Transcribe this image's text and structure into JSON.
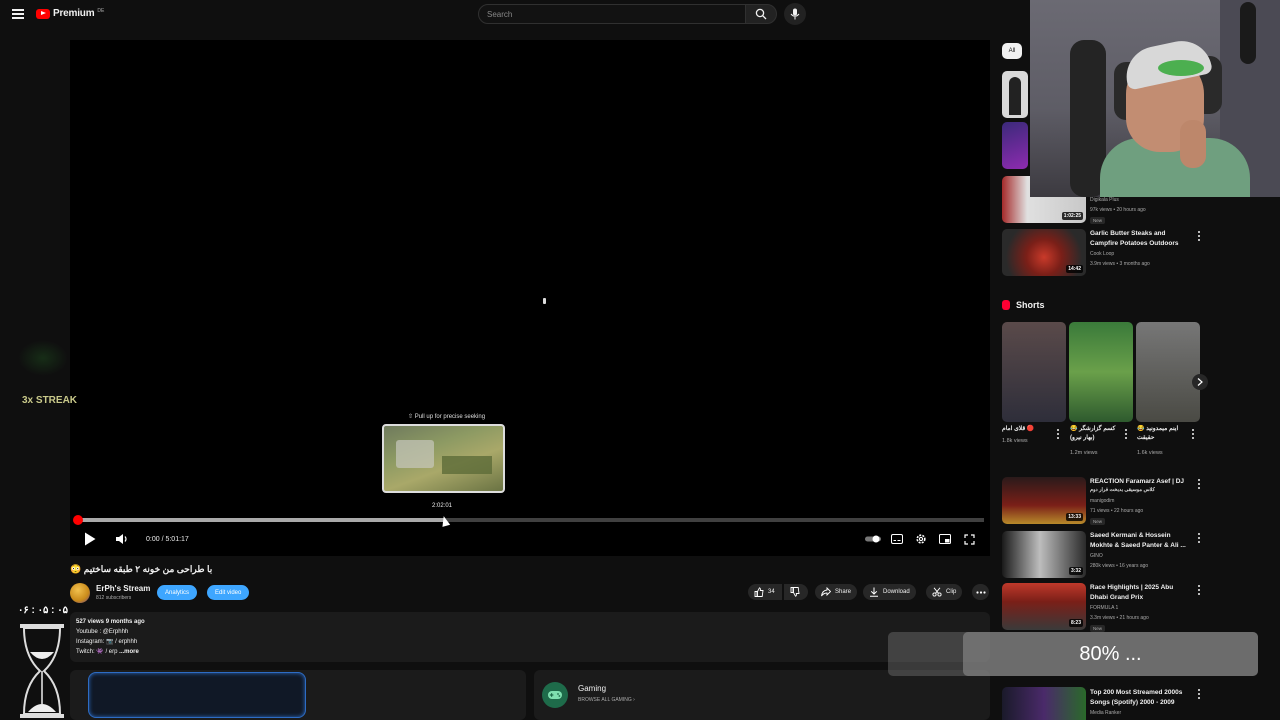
{
  "header": {
    "logo_text": "Premium",
    "logo_sup": "DE",
    "search_placeholder": "Search"
  },
  "player": {
    "seek_hint": "⇧ Pull up for precise seeking",
    "seek_time": "2:02:01",
    "time_display": "0:00 / 5:01:17",
    "progress_played_fraction": 0.0,
    "hover_fraction": 0.406
  },
  "video": {
    "title": "😳 با طراحی من خونه ۲ طبقه ساختیم",
    "channel_name": "ErPh's Stream",
    "subscribers": "812 subscribers",
    "analytics_label": "Analytics",
    "edit_label": "Edit video",
    "likes": "34",
    "share_label": "Share",
    "download_label": "Download",
    "clip_label": "Clip",
    "description": {
      "stats": "527 views  9 months ago",
      "line1": "Youtube : @Erphhh",
      "line2": "Instagram: 📷 / erphhh",
      "line3_prefix": "Twitch: 👾 / erp",
      "more": "...more"
    },
    "gaming_title": "Gaming",
    "gaming_browse": "BROWSE ALL GAMING"
  },
  "overlay": {
    "streak": "3x STREAK",
    "timer": "۰۶ : ۰۵ : ۰۵",
    "loading": "80% ..."
  },
  "sidebar": {
    "chip_all": "All",
    "items": [
      {
        "duration": "",
        "title": "",
        "channel": "",
        "meta": ""
      },
      {
        "duration": "",
        "title": "",
        "channel": "",
        "meta": ""
      },
      {
        "duration": "1:02:25",
        "title": "",
        "channel": "Digikala Plus",
        "meta": "97k views • 20 hours ago",
        "badge": "New"
      },
      {
        "duration": "14:42",
        "title": "Garlic Butter Steaks and Campfire Potatoes Outdoors",
        "channel": "Cook Loop",
        "meta": "3.9m views • 3 months ago"
      },
      {
        "duration": "13:33",
        "title": "REACTION Faramarz Asef | DJ",
        "subtitle": "کلاس موسیقی بدبخت فرار دوم",
        "channel": "manigodim",
        "meta": "71 views • 22 hours ago",
        "badge": "New"
      },
      {
        "duration": "3:32",
        "title": "Saeed Kermani & Hossein Mokhte & Saeed Panter & Ali ...",
        "channel": "GINO",
        "meta": "280k views • 16 years ago"
      },
      {
        "duration": "8:23",
        "title": "Race Highlights | 2025 Abu Dhabi Grand Prix",
        "channel": "FORMULA 1",
        "meta": "3.3m views • 21 hours ago",
        "badge": "New"
      },
      {
        "duration": "",
        "title": "Top 200 Most Streamed 2000s Songs (Spotify) 2000 - 2009",
        "channel": "Media Ranker",
        "meta": ""
      }
    ],
    "shorts_title": "Shorts",
    "shorts": [
      {
        "title": "قلای امام 🔴",
        "views": "1.8k views"
      },
      {
        "title": "کسم گزارشگر 😂 (بهار نیرو)",
        "views": "1.2m views"
      },
      {
        "title": "اینم میمدونید 😂 حقیقت",
        "views": "1.6k views"
      }
    ]
  },
  "colors": {
    "background": "#0f0f0f",
    "accent_red": "#ff0000",
    "button_blue": "#3ea6ff"
  }
}
